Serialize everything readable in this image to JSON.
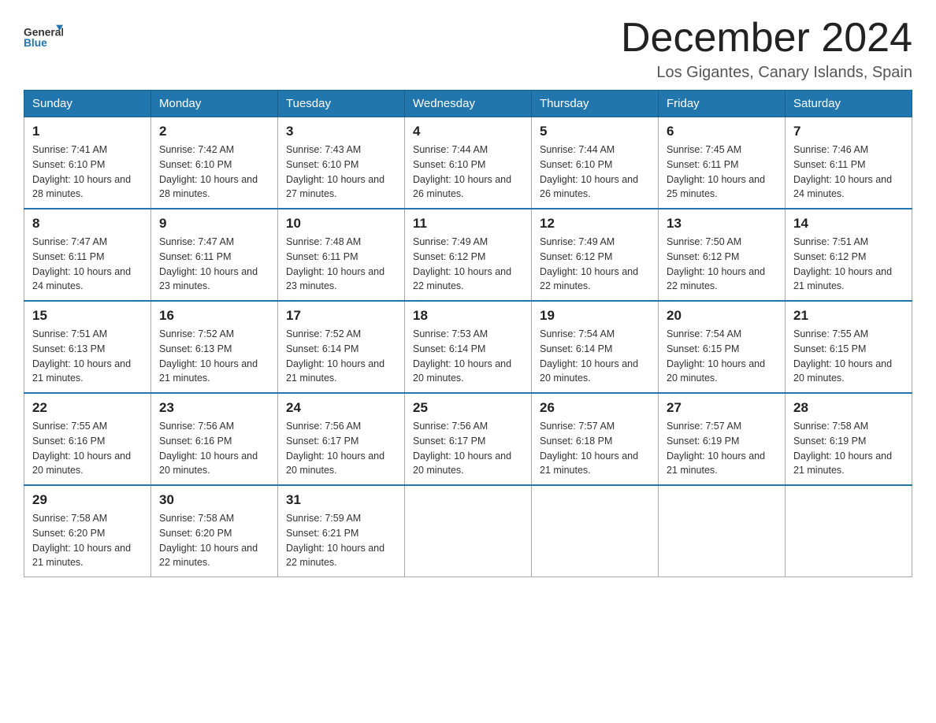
{
  "header": {
    "logo": {
      "text_general": "General",
      "text_blue": "Blue",
      "alt": "GeneralBlue logo"
    },
    "title": "December 2024",
    "location": "Los Gigantes, Canary Islands, Spain"
  },
  "columns": [
    "Sunday",
    "Monday",
    "Tuesday",
    "Wednesday",
    "Thursday",
    "Friday",
    "Saturday"
  ],
  "weeks": [
    [
      {
        "day": "1",
        "sunrise": "Sunrise: 7:41 AM",
        "sunset": "Sunset: 6:10 PM",
        "daylight": "Daylight: 10 hours and 28 minutes."
      },
      {
        "day": "2",
        "sunrise": "Sunrise: 7:42 AM",
        "sunset": "Sunset: 6:10 PM",
        "daylight": "Daylight: 10 hours and 28 minutes."
      },
      {
        "day": "3",
        "sunrise": "Sunrise: 7:43 AM",
        "sunset": "Sunset: 6:10 PM",
        "daylight": "Daylight: 10 hours and 27 minutes."
      },
      {
        "day": "4",
        "sunrise": "Sunrise: 7:44 AM",
        "sunset": "Sunset: 6:10 PM",
        "daylight": "Daylight: 10 hours and 26 minutes."
      },
      {
        "day": "5",
        "sunrise": "Sunrise: 7:44 AM",
        "sunset": "Sunset: 6:10 PM",
        "daylight": "Daylight: 10 hours and 26 minutes."
      },
      {
        "day": "6",
        "sunrise": "Sunrise: 7:45 AM",
        "sunset": "Sunset: 6:11 PM",
        "daylight": "Daylight: 10 hours and 25 minutes."
      },
      {
        "day": "7",
        "sunrise": "Sunrise: 7:46 AM",
        "sunset": "Sunset: 6:11 PM",
        "daylight": "Daylight: 10 hours and 24 minutes."
      }
    ],
    [
      {
        "day": "8",
        "sunrise": "Sunrise: 7:47 AM",
        "sunset": "Sunset: 6:11 PM",
        "daylight": "Daylight: 10 hours and 24 minutes."
      },
      {
        "day": "9",
        "sunrise": "Sunrise: 7:47 AM",
        "sunset": "Sunset: 6:11 PM",
        "daylight": "Daylight: 10 hours and 23 minutes."
      },
      {
        "day": "10",
        "sunrise": "Sunrise: 7:48 AM",
        "sunset": "Sunset: 6:11 PM",
        "daylight": "Daylight: 10 hours and 23 minutes."
      },
      {
        "day": "11",
        "sunrise": "Sunrise: 7:49 AM",
        "sunset": "Sunset: 6:12 PM",
        "daylight": "Daylight: 10 hours and 22 minutes."
      },
      {
        "day": "12",
        "sunrise": "Sunrise: 7:49 AM",
        "sunset": "Sunset: 6:12 PM",
        "daylight": "Daylight: 10 hours and 22 minutes."
      },
      {
        "day": "13",
        "sunrise": "Sunrise: 7:50 AM",
        "sunset": "Sunset: 6:12 PM",
        "daylight": "Daylight: 10 hours and 22 minutes."
      },
      {
        "day": "14",
        "sunrise": "Sunrise: 7:51 AM",
        "sunset": "Sunset: 6:12 PM",
        "daylight": "Daylight: 10 hours and 21 minutes."
      }
    ],
    [
      {
        "day": "15",
        "sunrise": "Sunrise: 7:51 AM",
        "sunset": "Sunset: 6:13 PM",
        "daylight": "Daylight: 10 hours and 21 minutes."
      },
      {
        "day": "16",
        "sunrise": "Sunrise: 7:52 AM",
        "sunset": "Sunset: 6:13 PM",
        "daylight": "Daylight: 10 hours and 21 minutes."
      },
      {
        "day": "17",
        "sunrise": "Sunrise: 7:52 AM",
        "sunset": "Sunset: 6:14 PM",
        "daylight": "Daylight: 10 hours and 21 minutes."
      },
      {
        "day": "18",
        "sunrise": "Sunrise: 7:53 AM",
        "sunset": "Sunset: 6:14 PM",
        "daylight": "Daylight: 10 hours and 20 minutes."
      },
      {
        "day": "19",
        "sunrise": "Sunrise: 7:54 AM",
        "sunset": "Sunset: 6:14 PM",
        "daylight": "Daylight: 10 hours and 20 minutes."
      },
      {
        "day": "20",
        "sunrise": "Sunrise: 7:54 AM",
        "sunset": "Sunset: 6:15 PM",
        "daylight": "Daylight: 10 hours and 20 minutes."
      },
      {
        "day": "21",
        "sunrise": "Sunrise: 7:55 AM",
        "sunset": "Sunset: 6:15 PM",
        "daylight": "Daylight: 10 hours and 20 minutes."
      }
    ],
    [
      {
        "day": "22",
        "sunrise": "Sunrise: 7:55 AM",
        "sunset": "Sunset: 6:16 PM",
        "daylight": "Daylight: 10 hours and 20 minutes."
      },
      {
        "day": "23",
        "sunrise": "Sunrise: 7:56 AM",
        "sunset": "Sunset: 6:16 PM",
        "daylight": "Daylight: 10 hours and 20 minutes."
      },
      {
        "day": "24",
        "sunrise": "Sunrise: 7:56 AM",
        "sunset": "Sunset: 6:17 PM",
        "daylight": "Daylight: 10 hours and 20 minutes."
      },
      {
        "day": "25",
        "sunrise": "Sunrise: 7:56 AM",
        "sunset": "Sunset: 6:17 PM",
        "daylight": "Daylight: 10 hours and 20 minutes."
      },
      {
        "day": "26",
        "sunrise": "Sunrise: 7:57 AM",
        "sunset": "Sunset: 6:18 PM",
        "daylight": "Daylight: 10 hours and 21 minutes."
      },
      {
        "day": "27",
        "sunrise": "Sunrise: 7:57 AM",
        "sunset": "Sunset: 6:19 PM",
        "daylight": "Daylight: 10 hours and 21 minutes."
      },
      {
        "day": "28",
        "sunrise": "Sunrise: 7:58 AM",
        "sunset": "Sunset: 6:19 PM",
        "daylight": "Daylight: 10 hours and 21 minutes."
      }
    ],
    [
      {
        "day": "29",
        "sunrise": "Sunrise: 7:58 AM",
        "sunset": "Sunset: 6:20 PM",
        "daylight": "Daylight: 10 hours and 21 minutes."
      },
      {
        "day": "30",
        "sunrise": "Sunrise: 7:58 AM",
        "sunset": "Sunset: 6:20 PM",
        "daylight": "Daylight: 10 hours and 22 minutes."
      },
      {
        "day": "31",
        "sunrise": "Sunrise: 7:59 AM",
        "sunset": "Sunset: 6:21 PM",
        "daylight": "Daylight: 10 hours and 22 minutes."
      },
      null,
      null,
      null,
      null
    ]
  ]
}
